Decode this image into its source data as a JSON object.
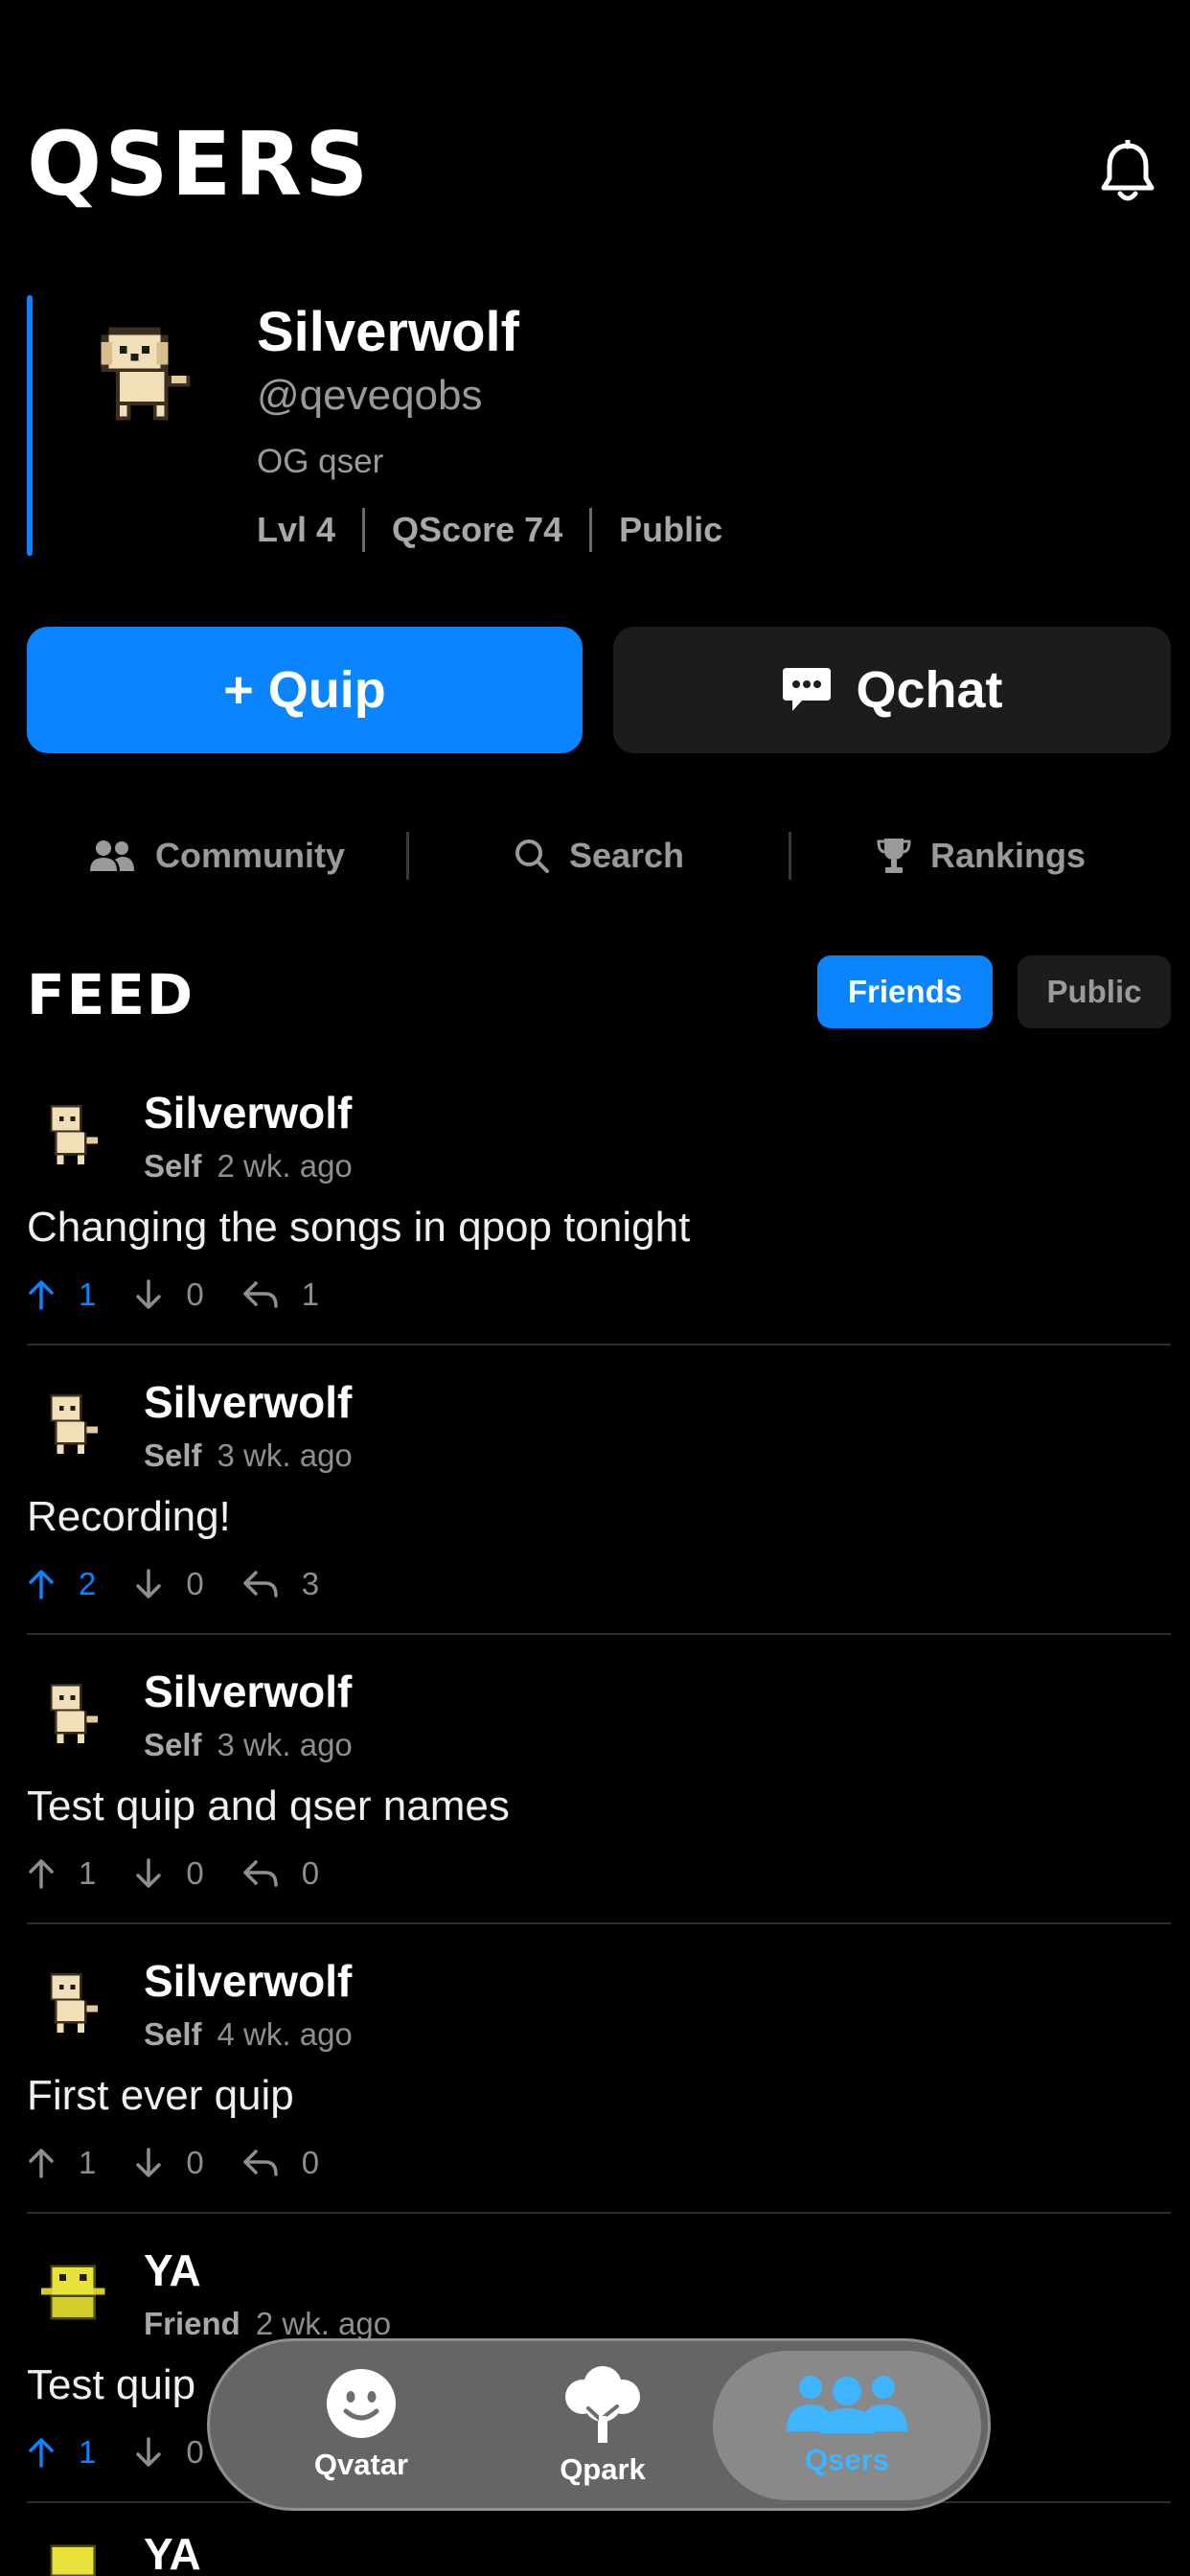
{
  "header": {
    "title": "QSERS",
    "notification_icon": "bell-icon"
  },
  "profile": {
    "display_name": "Silverwolf",
    "handle": "@qeveqobs",
    "badge": "OG qser",
    "level": "Lvl 4",
    "qscore": "QScore 74",
    "visibility": "Public",
    "accent_color": "#0a84ff"
  },
  "actions": {
    "quip_label": "+ Quip",
    "qchat_label": "Qchat"
  },
  "nav": {
    "community": "Community",
    "search": "Search",
    "rankings": "Rankings"
  },
  "feed": {
    "title": "FEED",
    "filter_friends": "Friends",
    "filter_public": "Public",
    "posts": [
      {
        "name": "Silverwolf",
        "relation": "Self",
        "time": "2 wk. ago",
        "text": "Changing the songs in qpop tonight",
        "up": "1",
        "down": "0",
        "replies": "1",
        "upvoted": true
      },
      {
        "name": "Silverwolf",
        "relation": "Self",
        "time": "3 wk. ago",
        "text": "Recording!",
        "up": "2",
        "down": "0",
        "replies": "3",
        "upvoted": true
      },
      {
        "name": "Silverwolf",
        "relation": "Self",
        "time": "3 wk. ago",
        "text": "Test quip and qser names",
        "up": "1",
        "down": "0",
        "replies": "0",
        "upvoted": false
      },
      {
        "name": "Silverwolf",
        "relation": "Self",
        "time": "4 wk. ago",
        "text": "First ever quip",
        "up": "1",
        "down": "0",
        "replies": "0",
        "upvoted": false
      },
      {
        "name": "YA",
        "relation": "Friend",
        "time": "2 wk. ago",
        "text": "Test quip",
        "up": "1",
        "down": "0",
        "replies": "",
        "upvoted": true
      },
      {
        "name": "YA"
      }
    ]
  },
  "tabbar": {
    "tab1": "Qvatar",
    "tab2": "Qpark",
    "tab3": "Qsers",
    "active": "Qsers",
    "active_color": "#3fb5ff"
  }
}
